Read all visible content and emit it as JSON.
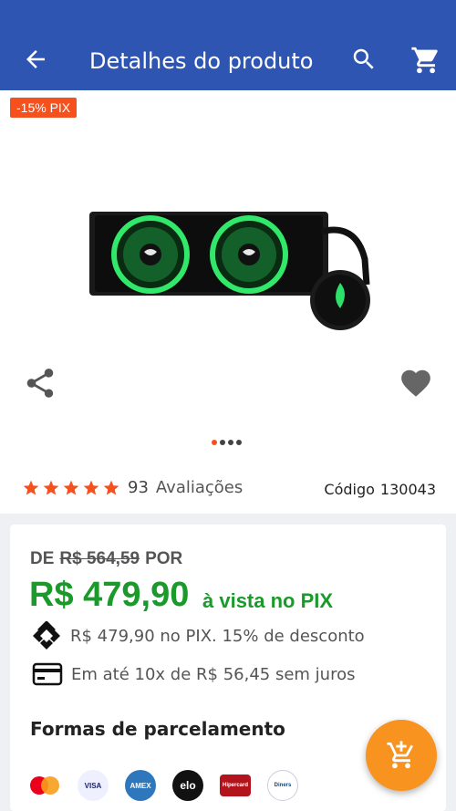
{
  "header": {
    "title": "Detalhes do produto"
  },
  "product": {
    "discount_badge": "-15% PIX",
    "image_alt": "Water cooler com fans RGB verdes",
    "carousel": {
      "count": 4,
      "active_index": 0
    },
    "rating": {
      "stars": 5,
      "count": "93",
      "label": "Avaliações"
    },
    "code_label": "Código",
    "code_value": "130043"
  },
  "pricing": {
    "de_label": "DE",
    "old_price": "R$ 564,59",
    "por_label": "POR",
    "new_price": "R$ 479,90",
    "pix_label": "à vista no PIX",
    "pix_info": "R$ 479,90 no PIX. 15% de desconto",
    "installments_info": "Em até 10x de R$ 56,45 sem juros",
    "formas_title": "Formas de parcelamento",
    "card_brands": [
      "Mastercard",
      "Visa",
      "American Express",
      "elo",
      "Hipercard",
      "Diners Club"
    ]
  },
  "colors": {
    "header_bg": "#2f55b3",
    "accent_orange": "#f4511e",
    "price_green": "#1a9a2a",
    "fab_orange": "#f7931e"
  }
}
